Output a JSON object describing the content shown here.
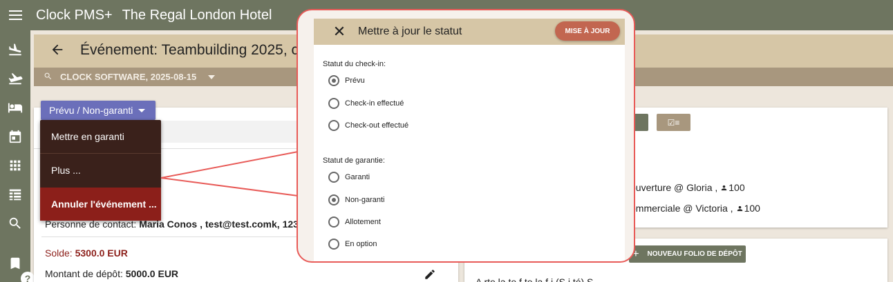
{
  "topbar": {
    "app_title": "Clock PMS+",
    "hotel_name": "The Regal London Hotel"
  },
  "sidebar": {
    "icons": [
      "plane-landing-icon",
      "plane-takeoff-icon",
      "bed-icon",
      "calendar-icon",
      "grid-icon",
      "list-icon",
      "search-icon",
      "bookmark-icon",
      "help-icon"
    ],
    "help_label": "?"
  },
  "page": {
    "title": "Événement: Teambuilding 2025, c"
  },
  "filter": {
    "text": "CLOCK SOFTWARE, 2025-08-15"
  },
  "status_button": {
    "label": "Prévu / Non-garanti"
  },
  "dropdown": {
    "items": [
      "Mettre en garanti",
      "Plus ...",
      "Annuler l'événement ..."
    ]
  },
  "left_card": {
    "contact_label": "Personne de contact:",
    "contact_value": "Maria Conos , test@test.comk, 123",
    "balance_label": "Solde:",
    "balance_value": "5300.0 EUR",
    "deposit_label": "Montant de dépôt:",
    "deposit_value": "5000.0 EUR"
  },
  "right_card": {
    "tan_button_label": "☑≡",
    "events": [
      {
        "text": "buverture @ Gloria ,",
        "count": "100"
      },
      {
        "text": "ommerciale @ Victoria ,",
        "count": "100"
      }
    ],
    "deposit_folio_button": "NOUVEAU FOLIO DE DÉPÔT",
    "plus_glyph": "+",
    "bottom_text": "A    rte   la    te   f   te  la f   i (S    i té)  S"
  },
  "modal": {
    "title": "Mettre à jour le statut",
    "update_button": "MISE À JOUR",
    "close_glyph": "✕",
    "checkin_group_label": "Statut du check-in:",
    "checkin_options": [
      {
        "label": "Prévu",
        "checked": true
      },
      {
        "label": "Check-in effectué",
        "checked": false
      },
      {
        "label": "Check-out effectué",
        "checked": false
      }
    ],
    "guarantee_group_label": "Statut de garantie:",
    "guarantee_options": [
      {
        "label": "Garanti",
        "checked": false
      },
      {
        "label": "Non-garanti",
        "checked": true
      },
      {
        "label": "Allotement",
        "checked": false
      },
      {
        "label": "En option",
        "checked": false
      }
    ]
  },
  "colors": {
    "topbar": "#6e7560",
    "header_band": "#d6c6a6",
    "filter_band": "#a8977e",
    "status_button": "#6b6fba",
    "dropdown": "#3a211b",
    "danger": "#8c1f1a",
    "callout": "#e85a57",
    "update_button": "#c26650"
  }
}
